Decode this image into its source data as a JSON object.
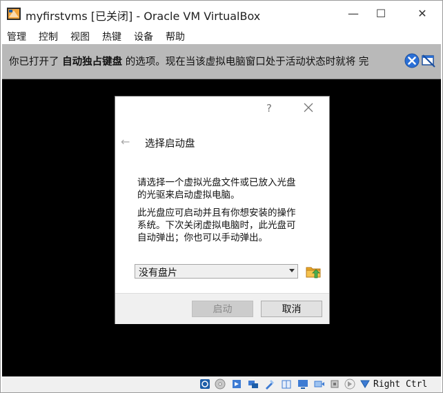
{
  "window": {
    "title": "myfirstvms [已关闭] - Oracle VM VirtualBox",
    "minimize_glyph": "—",
    "maximize_glyph": "☐",
    "close_glyph": "✕"
  },
  "menu": {
    "items": [
      "管理",
      "控制",
      "视图",
      "热键",
      "设备",
      "帮助"
    ]
  },
  "notification": {
    "text_prefix": "你已打开了 ",
    "text_bold": "自动独占键盘",
    "text_suffix": " 的选项。现在当该虚拟电脑窗口处于活动状态时就将 完"
  },
  "dialog": {
    "help_glyph": "?",
    "back_glyph": "←",
    "heading": "选择启动盘",
    "para1_line1": "请选择一个虚拟光盘文件或已放入光盘",
    "para1_line2": "的光驱来启动虚拟电脑。",
    "para2_line1": "此光盘应可启动并且有你想安装的操作",
    "para2_line2": "系统。下次关闭虚拟电脑时，此光盘可",
    "para2_line3": "自动弹出；你也可以手动弹出。",
    "selector_value": "没有盘片",
    "start_label": "启动",
    "cancel_label": "取消"
  },
  "statusbar": {
    "host_key": "Right Ctrl",
    "icons": [
      "hard-disk-icon",
      "optical-drive-icon",
      "audio-icon",
      "network-icon",
      "usb-icon",
      "shared-folder-icon",
      "display-icon",
      "video-capture-icon",
      "cpu-icon",
      "mouse-integration-icon",
      "keyboard-capture-icon"
    ]
  },
  "colors": {
    "notification_bg": "#b9b9b9",
    "screen_bg": "#000000",
    "close_icon_blue": "#2a6fd6",
    "folder_yellow": "#e8a727",
    "folder_arrow_green": "#4caf50"
  }
}
